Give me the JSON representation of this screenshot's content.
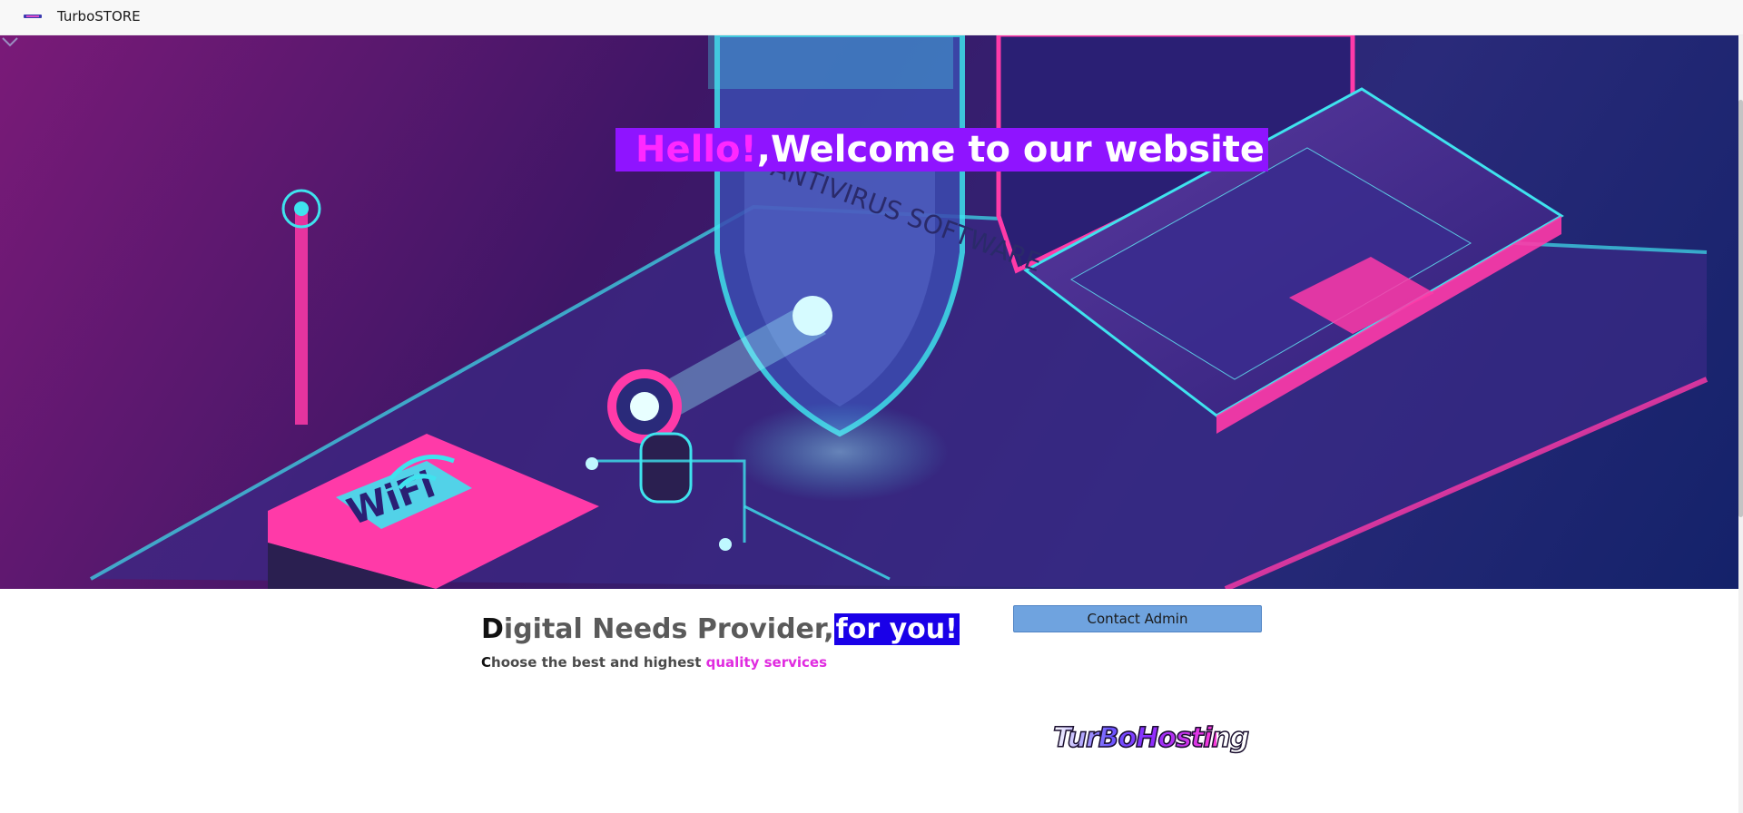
{
  "topbar": {
    "brand_name": "TurboSTORE",
    "brand_logo_icon": "store-logo-icon"
  },
  "hero": {
    "hello": "Hello!",
    "welcome": ",Welcome to our website",
    "illustration_text": "ANTIVIRUS SOFTWARE",
    "wifi_label": "WiFi",
    "chevron_icon": "chevron-down-icon",
    "colors": {
      "heading_bg": "#8f14ff",
      "hello": "#ff28ff",
      "accent_cyan": "#3fe3ee",
      "accent_pink": "#ff3aa8"
    }
  },
  "intro": {
    "title_initial": "D",
    "title_rest": "igital Needs Provider,",
    "title_highlight": "for you!",
    "sub_initial": "C",
    "sub_rest": "hoose the best and highest ",
    "sub_highlight": "quality services",
    "colors": {
      "highlight_bg": "#1a00e8",
      "pink": "#e02ce0"
    }
  },
  "contact": {
    "button_label": "Contact Admin",
    "button_color": "#6fa3df"
  },
  "partner": {
    "logo_text": "TurBoHosting"
  }
}
